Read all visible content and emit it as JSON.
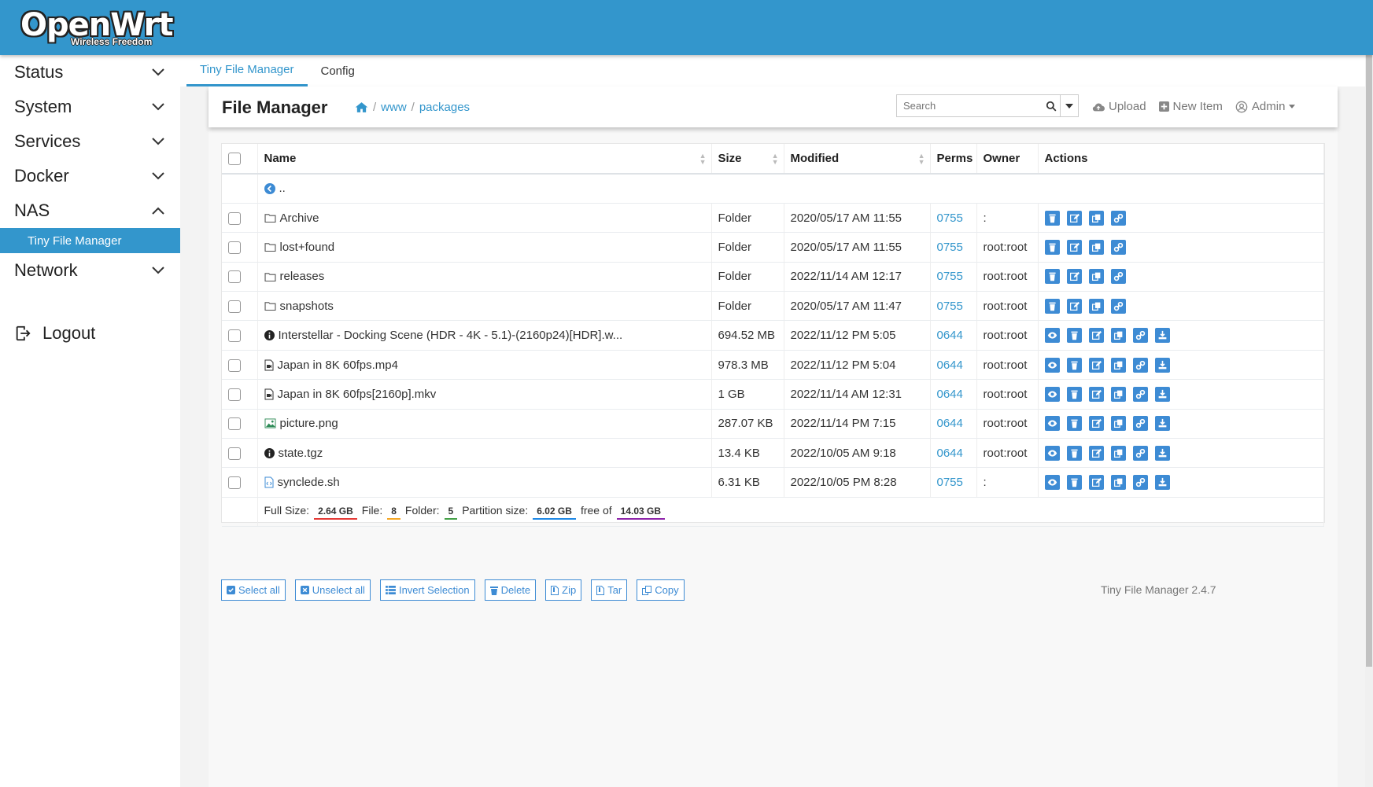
{
  "brand": {
    "logo_main": "OpenWrt",
    "logo_sub": "Wireless Freedom"
  },
  "sidebar": {
    "items": [
      {
        "label": "Status",
        "expanded": false
      },
      {
        "label": "System",
        "expanded": false
      },
      {
        "label": "Services",
        "expanded": false
      },
      {
        "label": "Docker",
        "expanded": false
      },
      {
        "label": "NAS",
        "expanded": true
      },
      {
        "label": "Network",
        "expanded": false
      }
    ],
    "active_sub": "Tiny File Manager",
    "logout": "Logout"
  },
  "tabs": [
    {
      "label": "Tiny File Manager",
      "active": true
    },
    {
      "label": "Config",
      "active": false
    }
  ],
  "header": {
    "title": "File Manager",
    "breadcrumb": [
      "www",
      "packages"
    ],
    "search_placeholder": "Search",
    "upload": "Upload",
    "new_item": "New Item",
    "admin": "Admin"
  },
  "table": {
    "headers": {
      "name": "Name",
      "size": "Size",
      "modified": "Modified",
      "perms": "Perms",
      "owner": "Owner",
      "actions": "Actions"
    },
    "parent_label": "..",
    "rows": [
      {
        "icon": "folder-icon",
        "name": "Archive",
        "size": "Folder",
        "modified": "2020/05/17 AM 11:55",
        "perms": "0755",
        "owner": ":",
        "is_file": false
      },
      {
        "icon": "folder-icon",
        "name": "lost+found",
        "size": "Folder",
        "modified": "2020/05/17 AM 11:55",
        "perms": "0755",
        "owner": "root:root",
        "is_file": false
      },
      {
        "icon": "folder-icon",
        "name": "releases",
        "size": "Folder",
        "modified": "2022/11/14 AM 12:17",
        "perms": "0755",
        "owner": "root:root",
        "is_file": false
      },
      {
        "icon": "folder-icon",
        "name": "snapshots",
        "size": "Folder",
        "modified": "2020/05/17 AM 11:47",
        "perms": "0755",
        "owner": "root:root",
        "is_file": false
      },
      {
        "icon": "info-icon",
        "name": "Interstellar - Docking Scene (HDR - 4K - 5.1)-(2160p24)[HDR].w...",
        "size": "694.52 MB",
        "modified": "2022/11/12 PM 5:05",
        "perms": "0644",
        "owner": "root:root",
        "is_file": true
      },
      {
        "icon": "video-file-icon",
        "name": "Japan in 8K 60fps.mp4",
        "size": "978.3 MB",
        "modified": "2022/11/12 PM 5:04",
        "perms": "0644",
        "owner": "root:root",
        "is_file": true
      },
      {
        "icon": "video-file-icon",
        "name": "Japan in 8K 60fps[2160p].mkv",
        "size": "1 GB",
        "modified": "2022/11/14 AM 12:31",
        "perms": "0644",
        "owner": "root:root",
        "is_file": true
      },
      {
        "icon": "image-file-icon",
        "name": "picture.png",
        "size": "287.07 KB",
        "modified": "2022/11/14 PM 7:15",
        "perms": "0644",
        "owner": "root:root",
        "is_file": true
      },
      {
        "icon": "info-icon",
        "name": "state.tgz",
        "size": "13.4 KB",
        "modified": "2022/10/05 AM 9:18",
        "perms": "0644",
        "owner": "root:root",
        "is_file": true
      },
      {
        "icon": "code-file-icon",
        "name": "synclede.sh",
        "size": "6.31 KB",
        "modified": "2022/10/05 PM 8:28",
        "perms": "0755",
        "owner": ":",
        "is_file": true
      }
    ],
    "footer": {
      "full_size_label": "Full Size:",
      "full_size": "2.64 GB",
      "file_label": "File:",
      "file_count": "8",
      "folder_label": "Folder:",
      "folder_count": "5",
      "partition_label": "Partition size:",
      "partition_size": "6.02 GB",
      "free_of_label": "free of",
      "total": "14.03 GB"
    }
  },
  "bottom_buttons": [
    "Select all",
    "Unselect all",
    "Invert Selection",
    "Delete",
    "Zip",
    "Tar",
    "Copy"
  ],
  "version": "Tiny File Manager 2.4.7",
  "colors": {
    "primary": "#3396cc",
    "action": "#3d8bd4",
    "badge_red": "#e53935",
    "badge_orange": "#f5a623",
    "badge_green": "#43a047",
    "badge_blue": "#1e88e5",
    "badge_purple": "#8e24aa"
  }
}
